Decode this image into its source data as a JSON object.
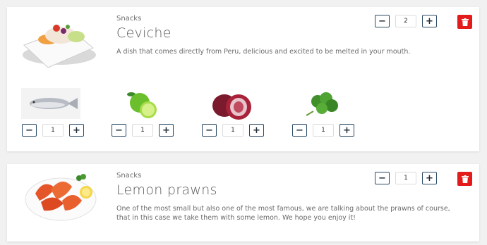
{
  "items": [
    {
      "category": "Snacks",
      "title": "Ceviche",
      "description": "A dish that comes directly from Peru, delicious and excited to be melted in your mouth.",
      "quantity": "2",
      "ingredients": [
        {
          "name": "fish",
          "quantity": "1"
        },
        {
          "name": "lime",
          "quantity": "1"
        },
        {
          "name": "red onion",
          "quantity": "1"
        },
        {
          "name": "cilantro",
          "quantity": "1"
        }
      ]
    },
    {
      "category": "Snacks",
      "title": "Lemon prawns",
      "description": "One of the most small but also one of the most famous, we are talking about the prawns of course, that in this case we take them with some lemon. We hope you enjoy it!",
      "quantity": "1"
    }
  ],
  "controls": {
    "minus": "−",
    "plus": "+"
  },
  "colors": {
    "delete": "#e31b1b",
    "stepper_border": "#2a4a66"
  }
}
